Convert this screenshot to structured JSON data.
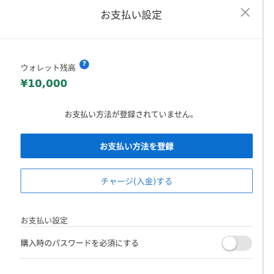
{
  "header": {
    "title": "お支払い設定",
    "close_icon": "close-icon"
  },
  "wallet": {
    "label": "ウォレット残高",
    "help_icon": "?",
    "balance": "¥10,000"
  },
  "payment": {
    "no_method_text": "お支払い方法が登録されていません。",
    "register_label": "お支払い方法を登録",
    "charge_label": "チャージ(入金)する"
  },
  "settings": {
    "section_title": "お支払い設定",
    "require_password_label": "購入時のパスワードを必須にする",
    "require_password_enabled": false
  },
  "colors": {
    "primary": "#0b6fd0",
    "balance": "#167a52",
    "outline": "#4d8fd6"
  }
}
